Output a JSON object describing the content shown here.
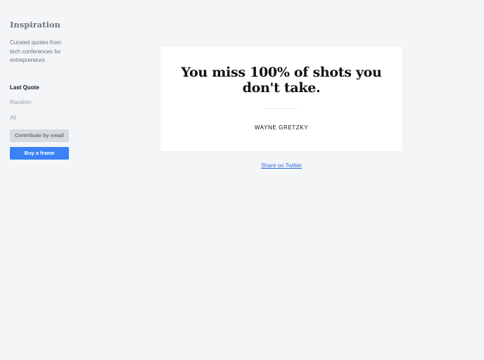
{
  "sidebar": {
    "brand": "Inspiration",
    "tagline": "Curated quotes from tech conferences for entrepreneurs",
    "nav": {
      "last_quote": "Last Quote",
      "random": "Random",
      "all": "All"
    },
    "contribute_label": "Contribute by email",
    "buy_label": "Buy a frame"
  },
  "quote": {
    "text": "You miss 100% of shots you don't take.",
    "author": "WAYNE GRETZKY"
  },
  "share_label": "Share on Twitter",
  "colors": {
    "background": "#f3f5f7",
    "accent": "#3b82f6",
    "link": "#2f6fd8"
  }
}
